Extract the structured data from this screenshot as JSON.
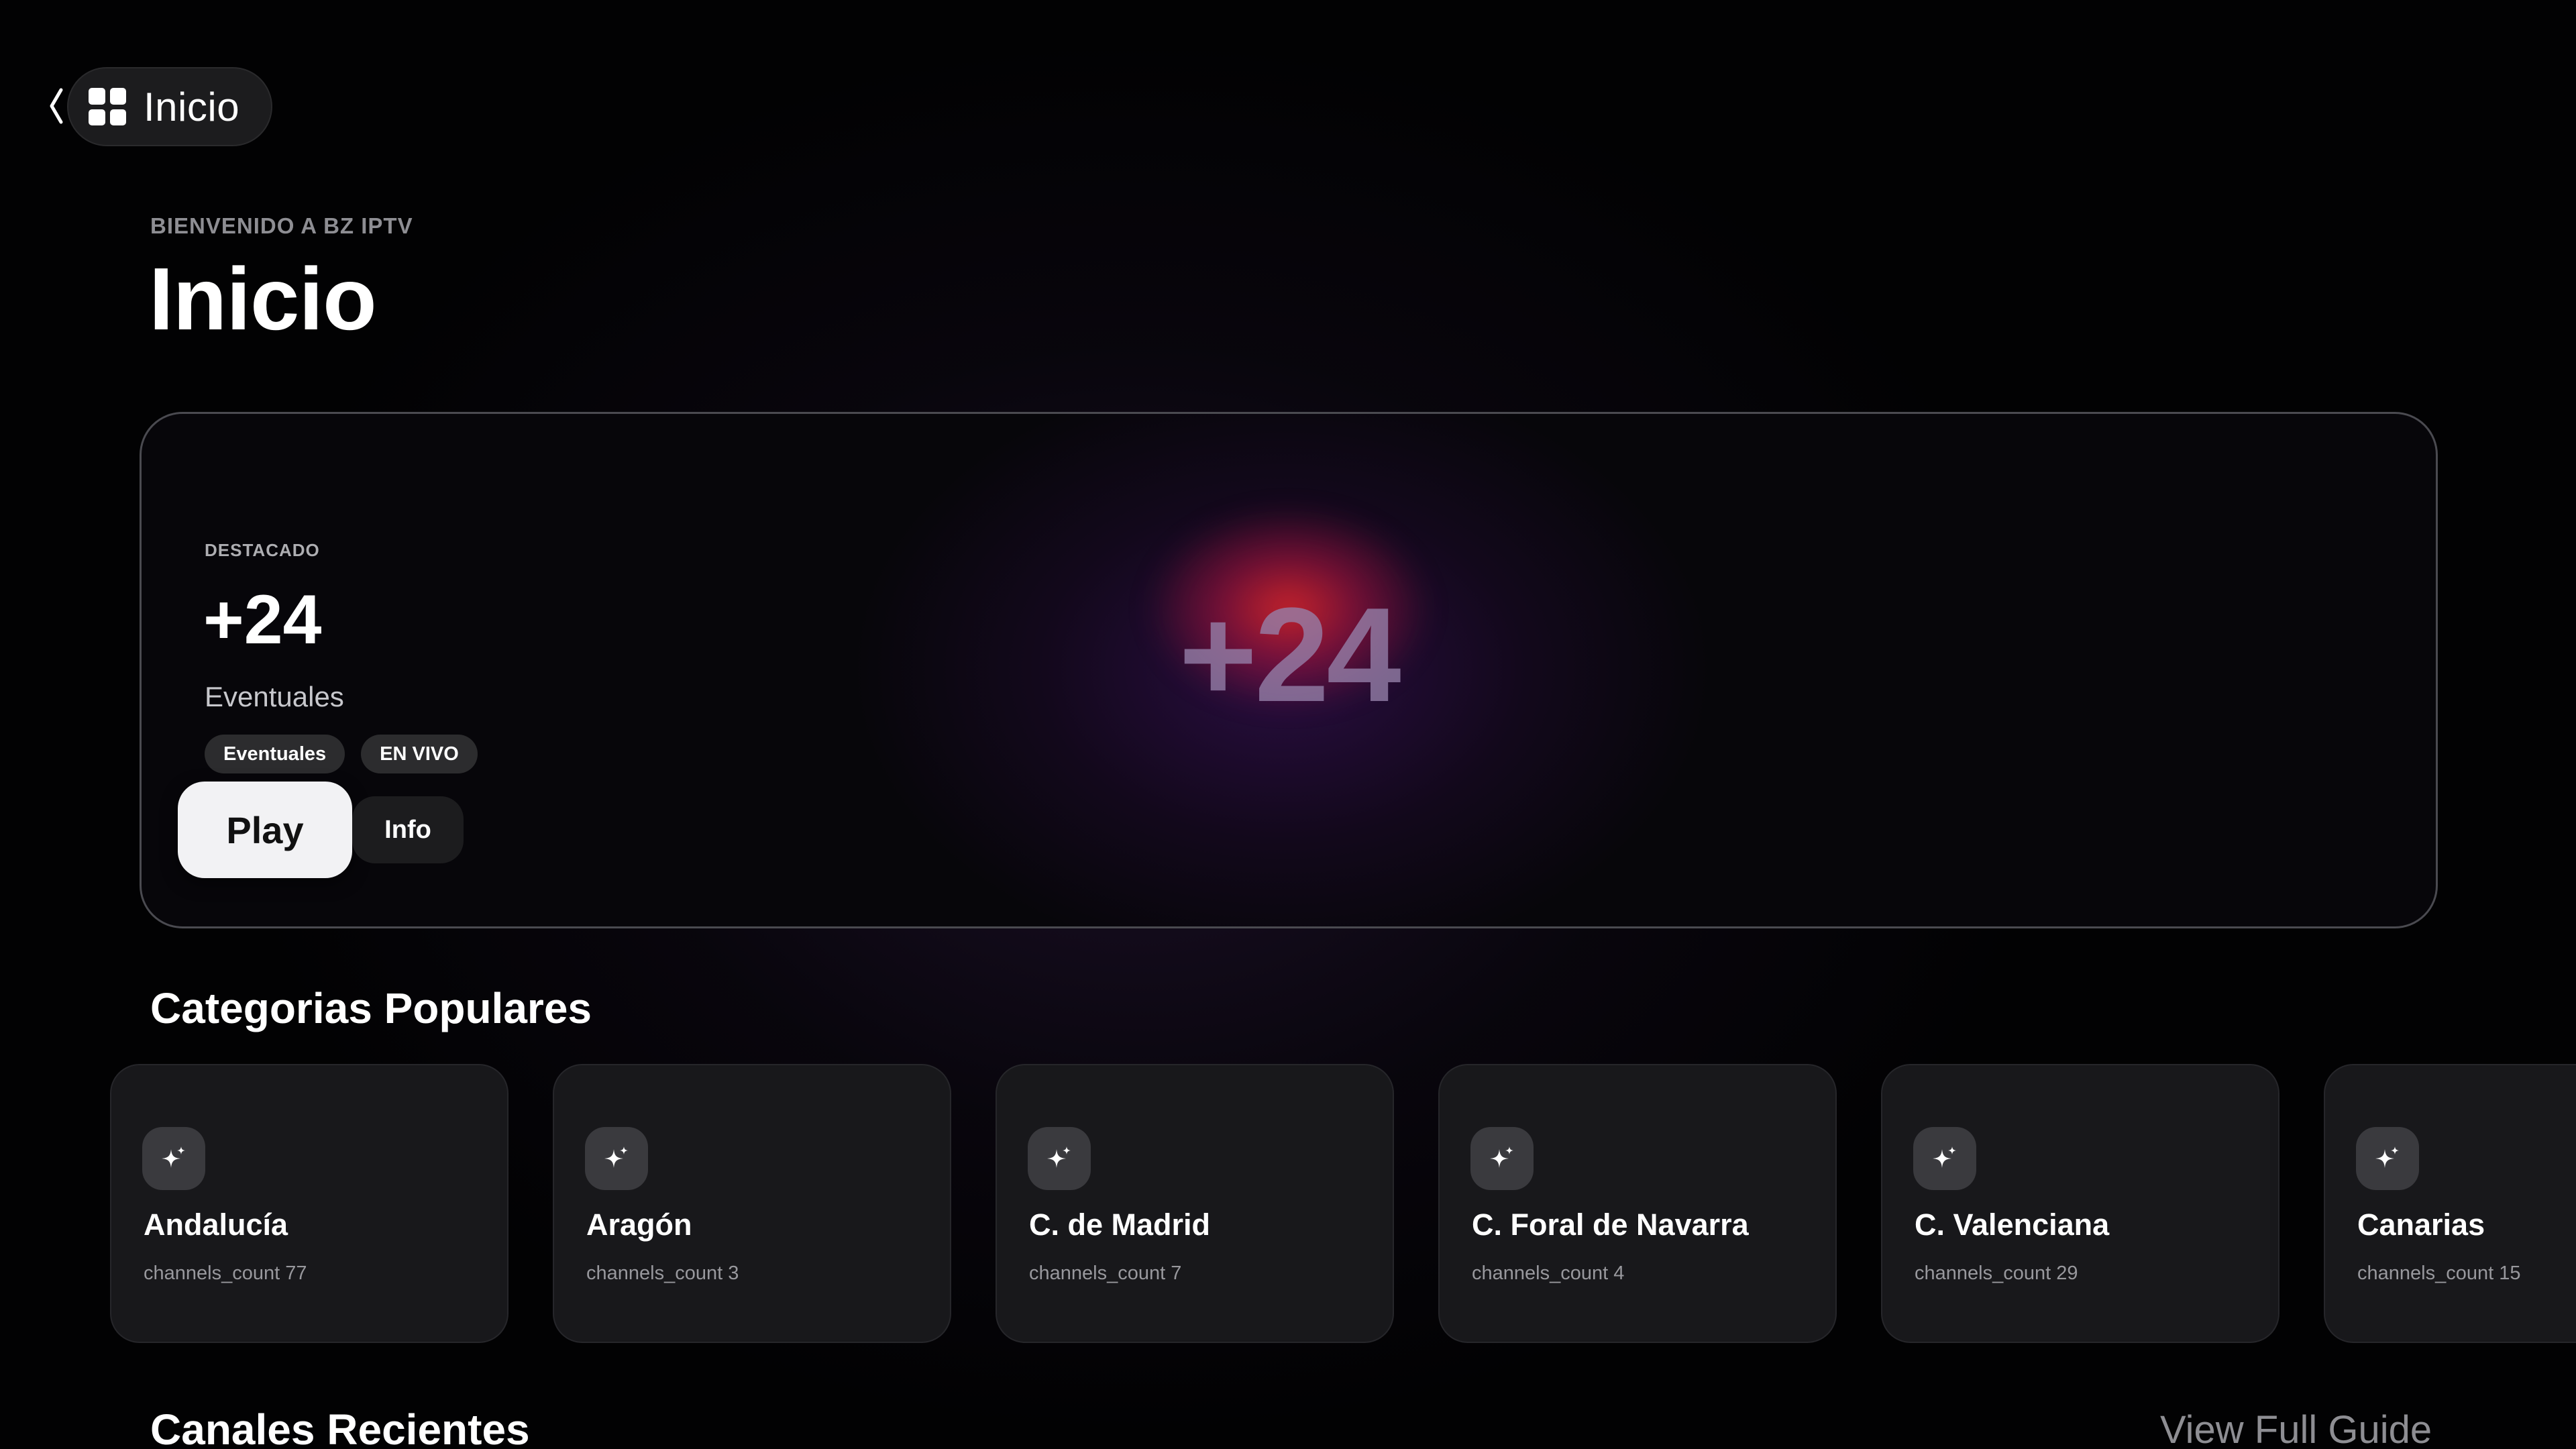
{
  "nav": {
    "label": "Inicio"
  },
  "header": {
    "eyebrow": "BIENVENIDO A BZ IPTV",
    "title": "Inicio"
  },
  "featured": {
    "eyebrow": "DESTACADO",
    "title": "+24",
    "subtitle": "Eventuales",
    "logo_text": "+24",
    "tags": [
      "Eventuales",
      "EN VIVO"
    ],
    "play_label": "Play",
    "info_label": "Info"
  },
  "categories": {
    "title": "Categorias Populares",
    "items": [
      {
        "name": "Andalucía",
        "count": "channels_count 77"
      },
      {
        "name": "Aragón",
        "count": "channels_count 3"
      },
      {
        "name": "C. de Madrid",
        "count": "channels_count 7"
      },
      {
        "name": "C. Foral de Navarra",
        "count": "channels_count 4"
      },
      {
        "name": "C. Valenciana",
        "count": "channels_count 29"
      },
      {
        "name": "Canarias",
        "count": "channels_count 15"
      }
    ]
  },
  "recent": {
    "title": "Canales Recientes",
    "view_guide_label": "View Full Guide"
  },
  "icons": {
    "back": "chevron-left-icon",
    "home": "grid-icon",
    "category": "sparkles-icon"
  }
}
